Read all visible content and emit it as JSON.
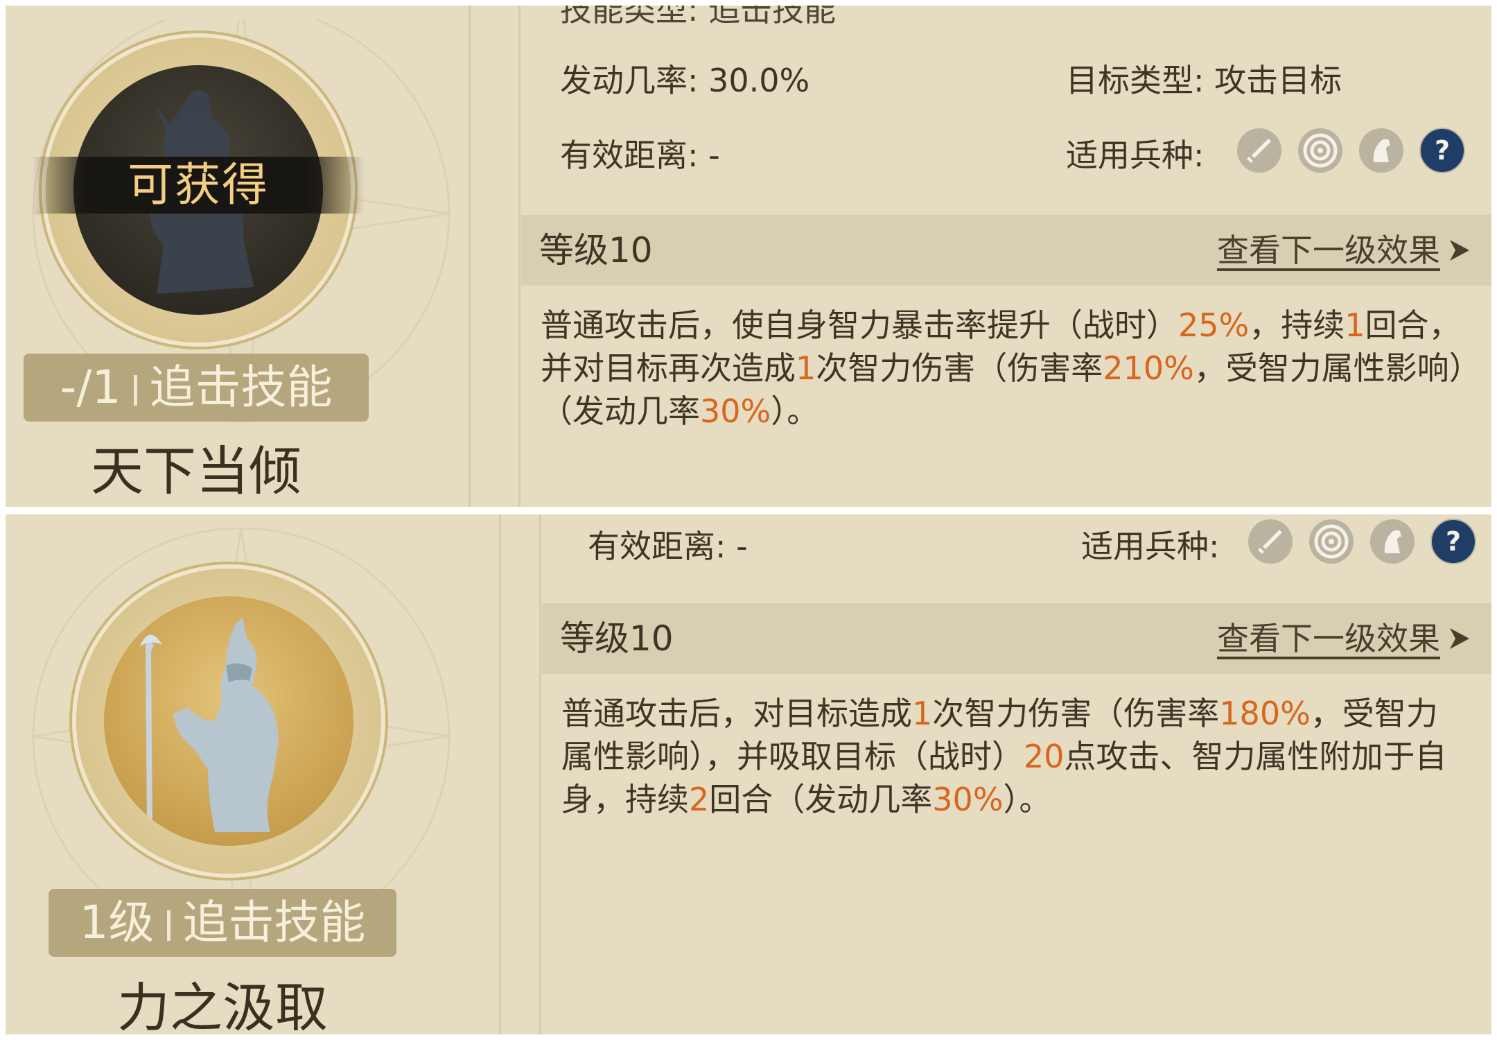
{
  "top_card": {
    "obtain_overlay": "可获得",
    "badge": {
      "level": "-/1",
      "type": "追击技能"
    },
    "name": "天下当倾",
    "header_cutoff_text": "技能类型: 追击技能",
    "stats": {
      "activation_rate": "发动几率: 30.0%",
      "target_type": "目标类型: 攻击目标",
      "effective_range": "有效距离: -",
      "troop_types_label": "适用兵种:"
    },
    "level_bar": {
      "label": "等级10",
      "next_link": "查看下一级效果"
    },
    "description": {
      "p1": "普通攻击后，使自身智力暴击率提升（战时）",
      "v1": "25%",
      "p2": "，持续",
      "v2": "1",
      "p3": "回合，并对目标再次造成",
      "v3": "1",
      "p4": "次智力伤害（伤害率",
      "v4": "210%",
      "p5": "，受智力属性影响）（发动几率",
      "v5": "30%",
      "p6": "）。"
    }
  },
  "bottom_card": {
    "badge": {
      "level": "1级",
      "type": "追击技能"
    },
    "name": "力之汲取",
    "stats": {
      "effective_range": "有效距离: -",
      "troop_types_label": "适用兵种:"
    },
    "level_bar": {
      "label": "等级10",
      "next_link": "查看下一级效果"
    },
    "description": {
      "p1": "普通攻击后，对目标造成",
      "v1": "1",
      "p2": "次智力伤害（伤害率",
      "v2": "180%",
      "p3": "，受智力属性影响），并吸取目标（战时）",
      "v3": "20",
      "p4": "点攻击、智力属性附加于自身，持续",
      "v4": "2",
      "p5": "回合（发动几率",
      "v5": "30%",
      "p6": "）。"
    }
  },
  "troop_icons": [
    "sword-icon",
    "target-icon",
    "horse-icon",
    "question-icon"
  ],
  "colors": {
    "panel_bg": "#e5dcc2",
    "level_bar_bg": "#d8cfb3",
    "highlight": "#d8661c",
    "badge_bg": "#b6a67e",
    "question_icon_bg": "#1f3d66"
  }
}
